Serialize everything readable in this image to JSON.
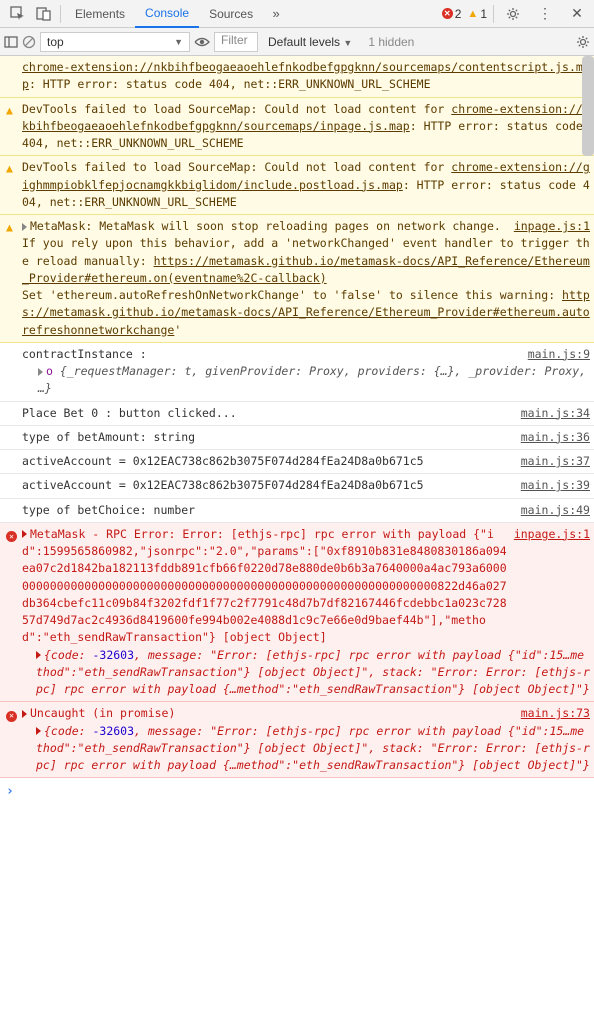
{
  "tabs": {
    "elements": "Elements",
    "console": "Console",
    "sources": "Sources"
  },
  "toolbar": {
    "err_count": "2",
    "warn_count": "1"
  },
  "subbar": {
    "context": "top",
    "filter_placeholder": "Filter",
    "levels": "Default levels",
    "hidden": "1 hidden"
  },
  "rows": [
    {
      "kind": "warn",
      "text_a": "chrome-extension://nkbihfbeogaeaoehlefnkodbefgpgknn/sourcemaps/contentscript.js.map",
      "text_b": ": HTTP error: status code 404, net::ERR_UNKNOWN_URL_SCHEME"
    },
    {
      "kind": "warn",
      "text_a": "DevTools failed to load SourceMap: Could not load content for ",
      "link": "chrome-extension://nkbihfbeogaeaoehlefnkodbefgpgknn/sourcemaps/inpage.js.map",
      "text_b": ": HTTP error: status code 404, net::ERR_UNKNOWN_URL_SCHEME"
    },
    {
      "kind": "warn",
      "text_a": "DevTools failed to load SourceMap: Could not load content for ",
      "link": "chrome-extension://gighmmpiobklfepjocnamgkkbiglidom/include.postload.js.map",
      "text_b": ": HTTP error: status code 404, net::ERR_UNKNOWN_URL_SCHEME"
    },
    {
      "kind": "warn-metamask",
      "line1": "MetaMask: MetaMask will soon stop reloading pages on network change.",
      "src": "inpage.js:1",
      "line2a": "If you rely upon this behavior, add a 'networkChanged' event handler to trigger the reload manually: ",
      "link2": "https://metamask.github.io/metamask-docs/API_Reference/Ethereum_Provider#ethereum.on(eventname%2C-callback)",
      "line3a": "Set 'ethereum.autoRefreshOnNetworkChange' to 'false' to silence this warning: ",
      "link3": "https://metamask.github.io/metamask-docs/API_Reference/Ethereum_Provider#ethereum.autorefreshonnetworkchange",
      "suffix": "'"
    },
    {
      "kind": "log-object",
      "text": "contractInstance :",
      "src": "main.js:9",
      "preview": " {_requestManager: t, givenProvider: Proxy, providers: {…}, _provider: Proxy, …}"
    },
    {
      "kind": "log",
      "text": "Place Bet  0 : button clicked...",
      "src": "main.js:34"
    },
    {
      "kind": "log",
      "text": "type of betAmount: string",
      "src": "main.js:36"
    },
    {
      "kind": "log",
      "text": "activeAccount = 0x12EAC738c862b3075F074d284fEa24D8a0b671c5",
      "src": "main.js:37"
    },
    {
      "kind": "log",
      "text": "activeAccount = 0x12EAC738c862b3075F074d284fEa24D8a0b671c5",
      "src": "main.js:39"
    },
    {
      "kind": "log",
      "text": "type of betChoice: number",
      "src": "main.js:49"
    },
    {
      "kind": "error-rpc",
      "title": "MetaMask - RPC Error: Error: [ethjs-rpc] rpc error with payload {\"id\":1599565860982,\"jsonrpc\":\"2.0\",\"params\":[\"0xf8910b831e8480830186a094ea07c2d1842ba182113fddb891cfb66f0220d78e880de0b6b3a7640000a4ac793a6000000000000000000000000000000000000000000000000000000000000000822d46a027db364cbefc11c09b84f3202fdf1f77c2f7791c48d7b7df82167446fcdebbc1a023c72857d749d7ac2c4936d8419600fe994b002e4088d1c9c7e66e0d9baef44b\"],\"method\":\"eth_sendRawTransaction\"} [object Object]",
      "src": "inpage.js:1",
      "code": "-32603",
      "msg": "\"Error: [ethjs-rpc] rpc error with payload {\"id\":15…method\":\"eth_sendRawTransaction\"} [object Object]\"",
      "stack": "\"Error: Error: [ethjs-rpc] rpc error with payload {…method\":\"eth_sendRawTransaction\"} [object Object]\""
    },
    {
      "kind": "error-rpc",
      "title": "Uncaught (in promise)",
      "src": "main.js:73",
      "code": "-32603",
      "msg": "\"Error: [ethjs-rpc] rpc error with payload {\"id\":15…method\":\"eth_sendRawTransaction\"} [object Object]\"",
      "stack": "\"Error: Error: [ethjs-rpc] rpc error with payload {…method\":\"eth_sendRawTransaction\"} [object Object]\""
    }
  ]
}
